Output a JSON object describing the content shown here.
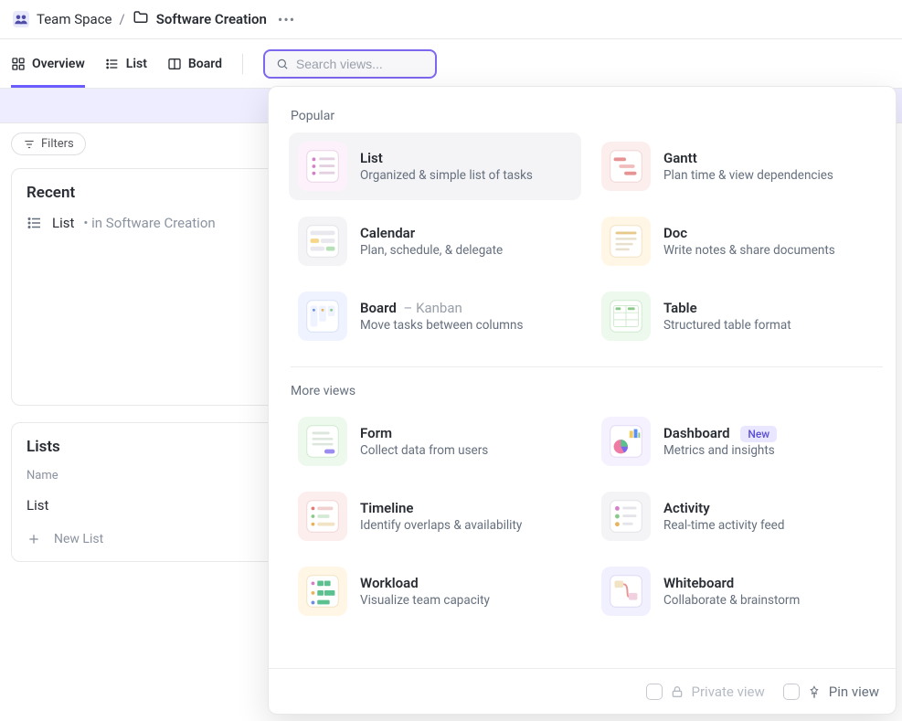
{
  "breadcrumb": {
    "workspace": "Team Space",
    "folder": "Software Creation"
  },
  "tabs": {
    "overview": "Overview",
    "list": "List",
    "board": "Board"
  },
  "search": {
    "placeholder": "Search views..."
  },
  "filters_label": "Filters",
  "recent": {
    "heading": "Recent",
    "item_name": "List",
    "item_context": "• in Software Creation"
  },
  "lists": {
    "heading": "Lists",
    "col_name": "Name",
    "row1": "List",
    "new_list": "New List"
  },
  "panel": {
    "section_popular": "Popular",
    "section_more": "More views",
    "options": {
      "list": {
        "title": "List",
        "desc": "Organized & simple list of tasks"
      },
      "gantt": {
        "title": "Gantt",
        "desc": "Plan time & view dependencies"
      },
      "calendar": {
        "title": "Calendar",
        "desc": "Plan, schedule, & delegate"
      },
      "doc": {
        "title": "Doc",
        "desc": "Write notes & share documents"
      },
      "board": {
        "title": "Board",
        "suffix": "– Kanban",
        "desc": "Move tasks between columns"
      },
      "table": {
        "title": "Table",
        "desc": "Structured table format"
      },
      "form": {
        "title": "Form",
        "desc": "Collect data from users"
      },
      "dashboard": {
        "title": "Dashboard",
        "badge": "New",
        "desc": "Metrics and insights"
      },
      "timeline": {
        "title": "Timeline",
        "desc": "Identify overlaps & availability"
      },
      "activity": {
        "title": "Activity",
        "desc": "Real-time activity feed"
      },
      "workload": {
        "title": "Workload",
        "desc": "Visualize team capacity"
      },
      "whiteboard": {
        "title": "Whiteboard",
        "desc": "Collaborate & brainstorm"
      }
    },
    "footer": {
      "private": "Private view",
      "pin": "Pin view"
    }
  }
}
